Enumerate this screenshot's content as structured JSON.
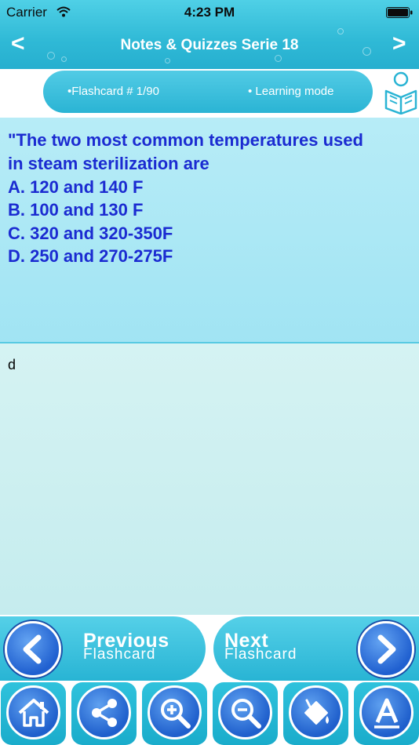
{
  "status_bar": {
    "carrier": "Carrier",
    "time": "4:23 PM"
  },
  "nav": {
    "title": "Notes & Quizzes Serie 18",
    "back_glyph": "<",
    "forward_glyph": ">"
  },
  "info": {
    "flashcard": "•Flashcard #  1/90",
    "mode": "• Learning mode"
  },
  "question": {
    "lines": [
      "\"The two most common temperatures used",
      "in steam sterilization are",
      "A. 120 and 140 F",
      "B. 100 and 130 F",
      "C. 320 and 320-350F",
      "D. 250 and 270-275F"
    ]
  },
  "answer": {
    "text": "d"
  },
  "controls": {
    "previous_big": "Previous",
    "previous_small": "Flashcard",
    "next_big": "Next",
    "next_small": "Flashcard"
  },
  "toolbar": {
    "icons": [
      "home-icon",
      "share-icon",
      "zoom-in-icon",
      "zoom-out-icon",
      "paint-bucket-icon",
      "font-a-icon"
    ]
  },
  "colors": {
    "accent": "#2fb9d6",
    "question_text": "#1b2bd1",
    "button_blue": "#2060d0"
  }
}
